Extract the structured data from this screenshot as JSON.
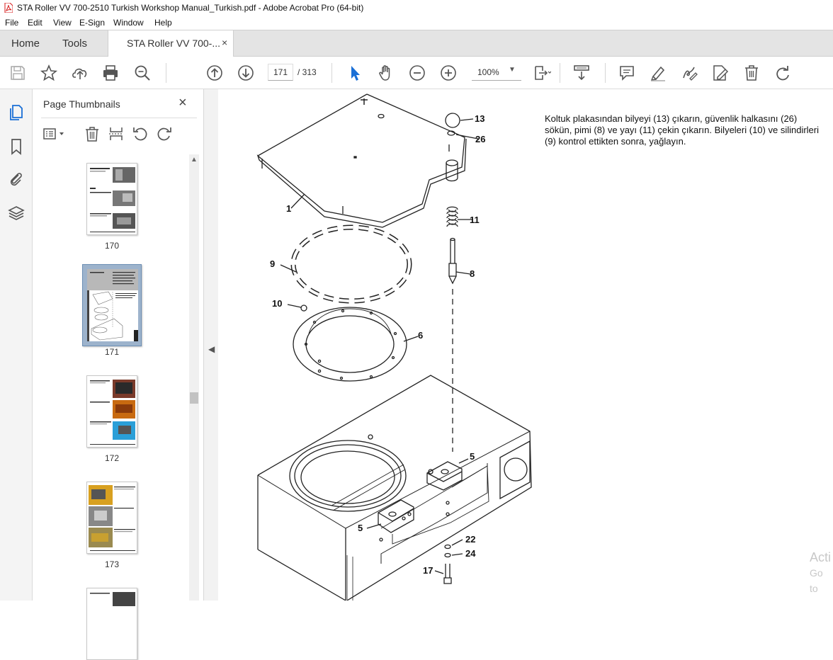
{
  "window": {
    "title": "STA Roller VV 700-2510 Turkish Workshop Manual_Turkish.pdf - Adobe Acrobat Pro (64-bit)"
  },
  "menu": [
    "File",
    "Edit",
    "View",
    "E-Sign",
    "Window",
    "Help"
  ],
  "tabs": {
    "home": "Home",
    "tools": "Tools",
    "document": "STA Roller VV 700-...",
    "close": "×"
  },
  "toolbar": {
    "current_page": "171",
    "total_pages": "/ 313",
    "zoom": "100%",
    "icons": [
      "save-icon",
      "bookmark-star-icon",
      "upload-icon",
      "print-icon",
      "find-zoom-icon",
      "page-up-icon",
      "page-down-icon",
      "select-arrow-icon",
      "hand-icon",
      "zoom-out-icon",
      "zoom-in-icon",
      "fit-page-icon",
      "scroll-mode-icon",
      "comment-icon",
      "highlight-icon",
      "sign-icon",
      "edit-pdf-icon",
      "delete-icon",
      "redo-icon"
    ]
  },
  "sidebar": {
    "title": "Page Thumbnails",
    "close": "×",
    "thumbnails": [
      {
        "page": "170",
        "selected": false
      },
      {
        "page": "171",
        "selected": true
      },
      {
        "page": "172",
        "selected": false
      },
      {
        "page": "173",
        "selected": false
      }
    ]
  },
  "document": {
    "paragraph": "Koltuk plakasından bilyeyi (13) çıkarın, güvenlik halkasını (26) sökün, pimi (8) ve yayı (11) çekin çıkarın. Bilyeleri (10) ve silindirleri (9) kontrol ettikten sonra, yağlayın.",
    "callouts": [
      "13",
      "26",
      "1",
      "11",
      "9",
      "8",
      "10",
      "6",
      "5",
      "5",
      "22",
      "24",
      "17"
    ]
  },
  "watermark": {
    "line1": "Acti",
    "line2": "Go to"
  },
  "colors": {
    "accent_blue": "#1a6fd6",
    "pdf_red": "#d71a1a",
    "selected_thumb": "#9db3cc"
  }
}
